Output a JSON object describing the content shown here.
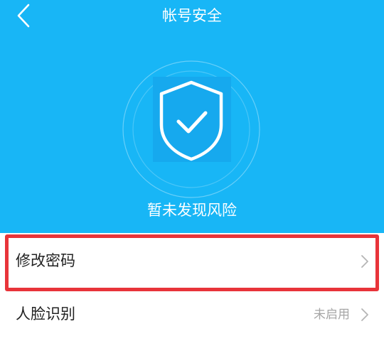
{
  "header": {
    "title": "帐号安全",
    "back_icon": "chevron-left-icon"
  },
  "hero": {
    "status": "暂未发现风险",
    "icon": "shield-check-icon",
    "background_color": "#18b6f6"
  },
  "settings": [
    {
      "label": "修改密码",
      "value": "",
      "icon": "chevron-right-icon"
    },
    {
      "label": "人脸识别",
      "value": "未启用",
      "icon": "chevron-right-icon"
    }
  ],
  "highlight": {
    "target": "修改密码",
    "color": "#e8343a"
  }
}
